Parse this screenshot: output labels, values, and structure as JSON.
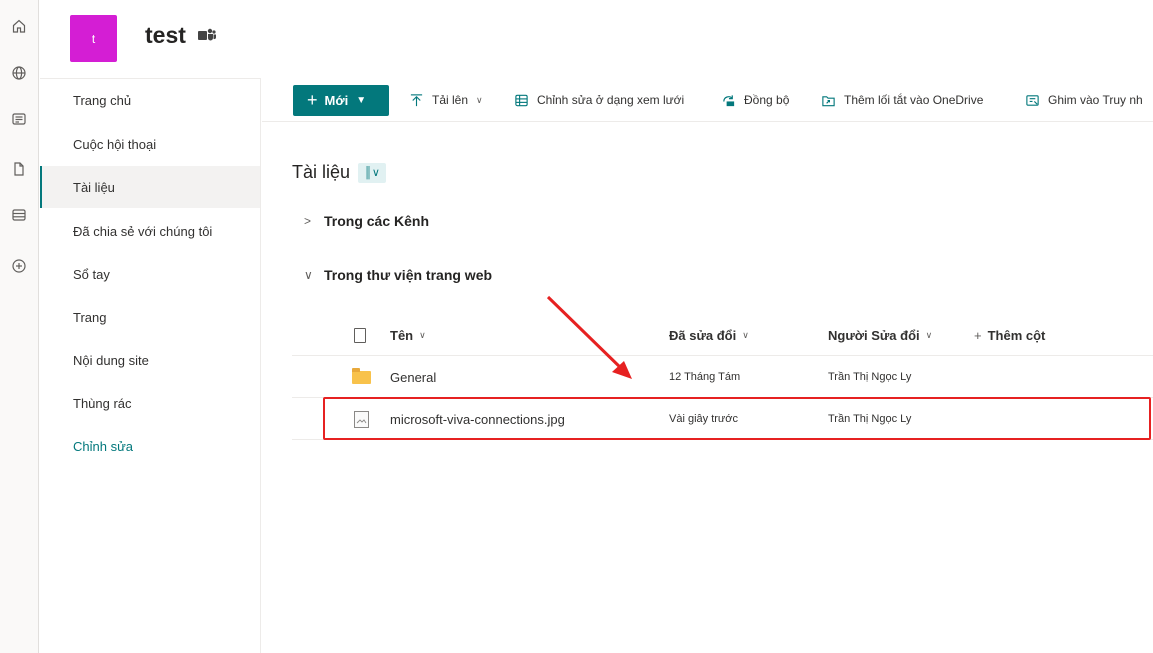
{
  "site": {
    "logo_letter": "t",
    "title": "test",
    "colors": {
      "logo_bg": "#d41ed4",
      "accent": "#03787c"
    }
  },
  "rail": {
    "icons": [
      "home-icon",
      "globe-icon",
      "news-icon",
      "document-icon",
      "list-icon",
      "add-icon"
    ]
  },
  "nav": {
    "items": [
      {
        "label": "Trang chủ"
      },
      {
        "label": "Cuộc hội thoại"
      },
      {
        "label": "Tài liệu",
        "selected": true
      },
      {
        "label": "Đã chia sẻ với chúng tôi"
      },
      {
        "label": "Sổ tay"
      },
      {
        "label": "Trang"
      },
      {
        "label": "Nội dung site"
      },
      {
        "label": "Thùng rác"
      }
    ],
    "edit_label": "Chỉnh sửa"
  },
  "commandbar": {
    "new_label": "Mới",
    "upload_label": "Tải lên",
    "grid_label": "Chỉnh sửa ở dạng xem lưới",
    "sync_label": "Đồng bộ",
    "shortcut_label": "Thêm lối tắt vào OneDrive",
    "pin_label": "Ghim vào Truy nh"
  },
  "library": {
    "title": "Tài liệu",
    "groups": {
      "channels": "Trong các Kênh",
      "site_library": "Trong thư viện trang web"
    },
    "columns": {
      "name": "Tên",
      "modified": "Đã sửa đổi",
      "modified_by": "Người Sửa đổi",
      "add_column": "Thêm cột"
    },
    "rows": [
      {
        "type": "folder",
        "name": "General",
        "modified": "12 Tháng Tám",
        "modified_by": "Trần Thị Ngọc Ly"
      },
      {
        "type": "image",
        "name": "microsoft-viva-connections.jpg",
        "modified": "Vài giây trước",
        "modified_by": "Trần Thị Ngọc Ly"
      }
    ]
  },
  "annotation": {
    "color": "#e62121"
  }
}
